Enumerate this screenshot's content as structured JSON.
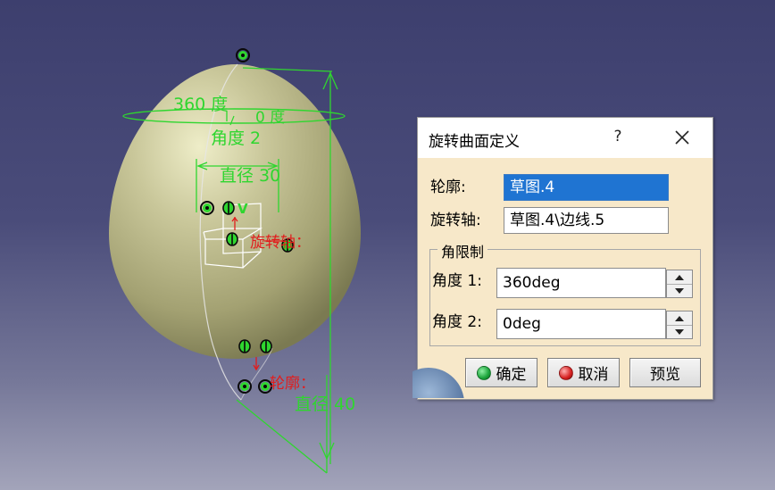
{
  "viewport": {
    "annotations": {
      "angle_360": "360 度",
      "angle_0": "0 度",
      "angle2": "角度 2",
      "diameter_30": "直径 30",
      "rotation_axis": "旋转轴：",
      "profile": "轮廓：",
      "diameter_40": "直径 40",
      "v_label": "V"
    }
  },
  "dialog": {
    "title": "旋转曲面定义",
    "help": "?",
    "profile_label": "轮廓:",
    "profile_value": "草图.4",
    "axis_label": "旋转轴:",
    "axis_value": "草图.4\\边线.5",
    "group_title": "角限制",
    "angle1_label": "角度 1:",
    "angle1_value": "360deg",
    "angle2_label": "角度 2:",
    "angle2_value": "0deg",
    "ok_label": "确定",
    "cancel_label": "取消",
    "preview_label": "预览"
  },
  "colors": {
    "dimension_green": "#2fd62f",
    "constraint_red": "#e11d1d",
    "egg_surface": "#b4b282",
    "selection_blue": "#1f74d2",
    "ok_led": "#1aa33a",
    "cancel_led": "#d62020"
  }
}
